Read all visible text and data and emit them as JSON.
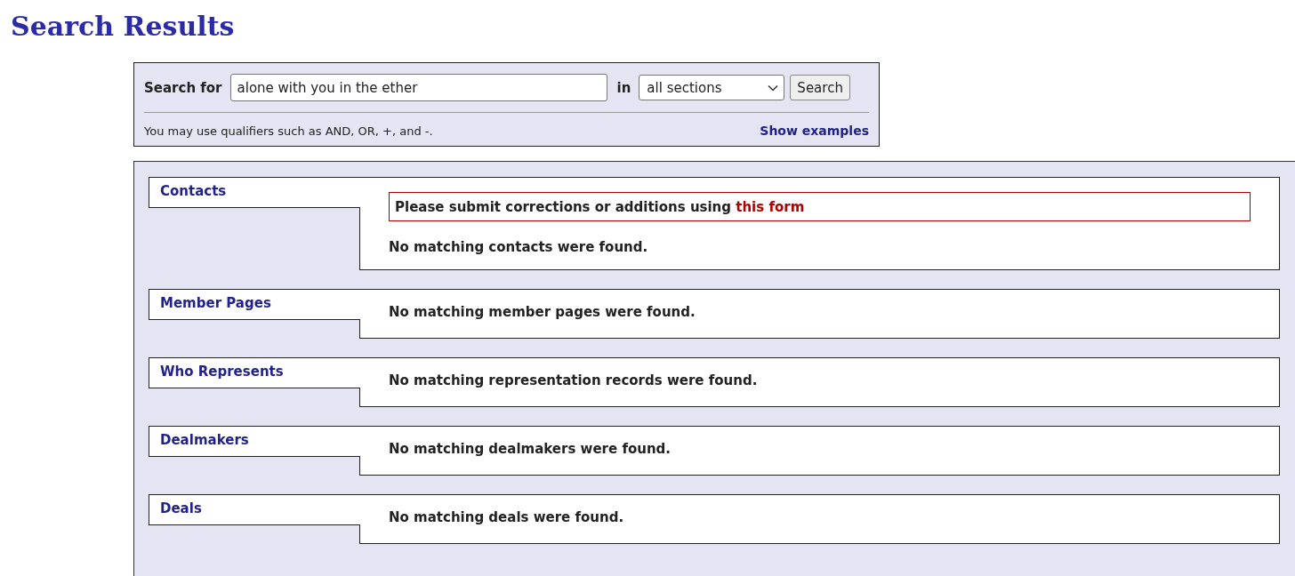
{
  "page_title": "Search Results",
  "search": {
    "label": "Search for",
    "value": "alone with you in the ether",
    "in_label": "in",
    "scope": "all sections",
    "button": "Search",
    "hint": "You may use qualifiers such as AND, OR, +, and -.",
    "examples_link": "Show examples"
  },
  "sections": [
    {
      "title": "Contacts",
      "notice": {
        "text": "Please submit corrections or additions using ",
        "link": "this form"
      },
      "message": "No matching contacts were found."
    },
    {
      "title": "Member Pages",
      "message": "No matching member pages were found."
    },
    {
      "title": "Who Represents",
      "message": "No matching representation records were found."
    },
    {
      "title": "Dealmakers",
      "message": "No matching dealmakers were found."
    },
    {
      "title": "Deals",
      "message": "No matching deals were found."
    }
  ]
}
